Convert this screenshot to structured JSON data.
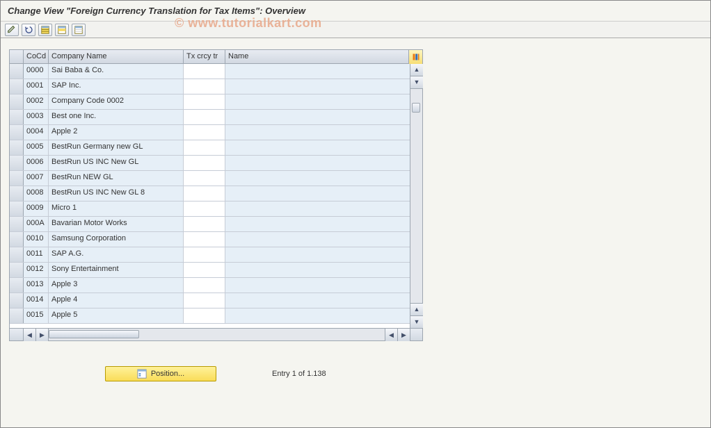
{
  "window_title": "Change View \"Foreign Currency Translation for Tax Items\": Overview",
  "watermark": "© www.tutorialkart.com",
  "columns": {
    "cocd": "CoCd",
    "company_name": "Company Name",
    "tx_crcy_tr": "Tx crcy tr",
    "name": "Name"
  },
  "rows": [
    {
      "cocd": "0000",
      "company_name": "Sai Baba & Co.",
      "tx": "",
      "name": ""
    },
    {
      "cocd": "0001",
      "company_name": "SAP Inc.",
      "tx": "",
      "name": ""
    },
    {
      "cocd": "0002",
      "company_name": "Company Code 0002",
      "tx": "",
      "name": ""
    },
    {
      "cocd": "0003",
      "company_name": "Best one Inc.",
      "tx": "",
      "name": ""
    },
    {
      "cocd": "0004",
      "company_name": "Apple 2",
      "tx": "",
      "name": ""
    },
    {
      "cocd": "0005",
      "company_name": "BestRun Germany new GL",
      "tx": "",
      "name": ""
    },
    {
      "cocd": "0006",
      "company_name": "BestRun US INC New GL",
      "tx": "",
      "name": ""
    },
    {
      "cocd": "0007",
      "company_name": "BestRun NEW GL",
      "tx": "",
      "name": ""
    },
    {
      "cocd": "0008",
      "company_name": "BestRun US INC New GL 8",
      "tx": "",
      "name": ""
    },
    {
      "cocd": "0009",
      "company_name": "Micro 1",
      "tx": "",
      "name": ""
    },
    {
      "cocd": "000A",
      "company_name": "Bavarian Motor Works",
      "tx": "",
      "name": ""
    },
    {
      "cocd": "0010",
      "company_name": "Samsung Corporation",
      "tx": "",
      "name": ""
    },
    {
      "cocd": "0011",
      "company_name": "SAP A.G.",
      "tx": "",
      "name": ""
    },
    {
      "cocd": "0012",
      "company_name": "Sony Entertainment",
      "tx": "",
      "name": ""
    },
    {
      "cocd": "0013",
      "company_name": "Apple 3",
      "tx": "",
      "name": ""
    },
    {
      "cocd": "0014",
      "company_name": "Apple 4",
      "tx": "",
      "name": ""
    },
    {
      "cocd": "0015",
      "company_name": "Apple 5",
      "tx": "",
      "name": ""
    }
  ],
  "footer": {
    "position_label": "Position...",
    "entry_label": "Entry 1 of 1.138"
  },
  "toolbar_icons": {
    "display_change": "display-change",
    "undo": "undo",
    "select_all": "select-all",
    "select_block": "select-block",
    "deselect_all": "deselect-all"
  }
}
